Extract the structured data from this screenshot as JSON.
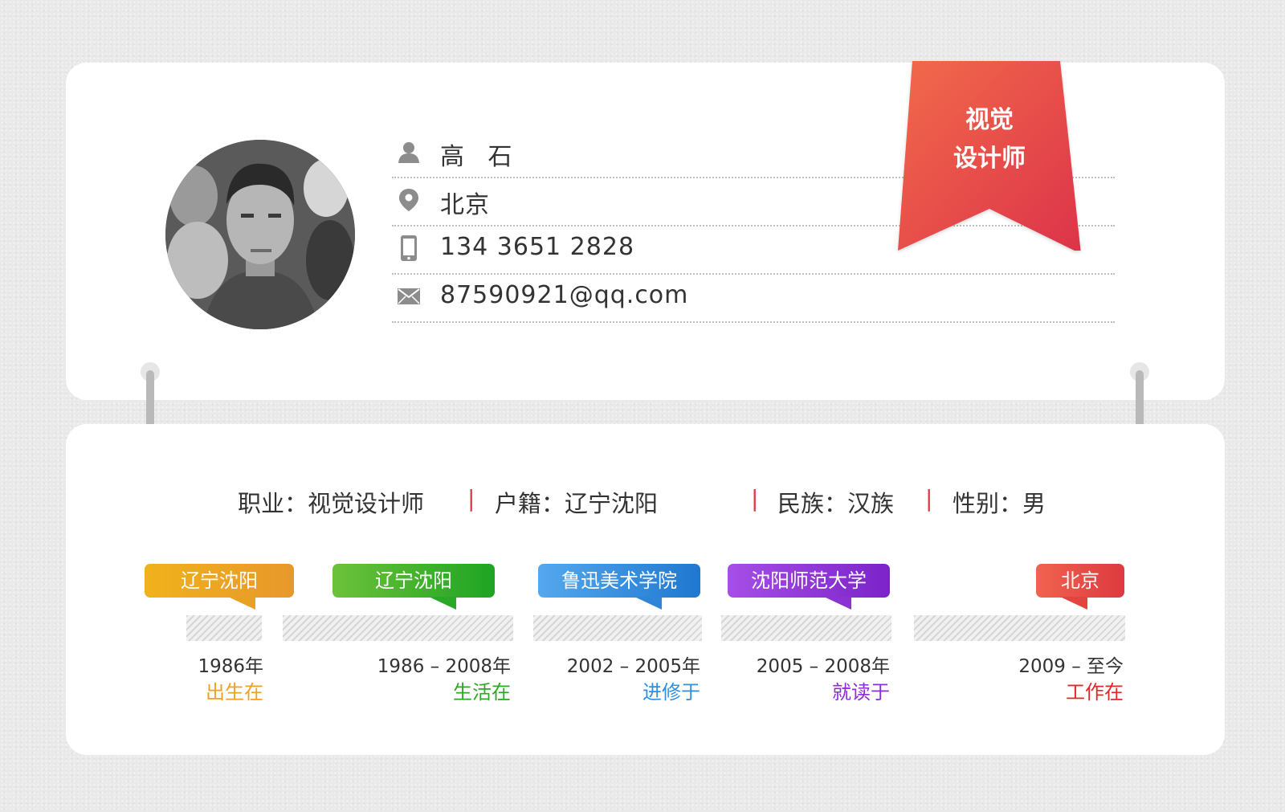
{
  "profile": {
    "name": "高 石",
    "city": "北京",
    "phone": "134  3651  2828",
    "email": "87590921@qq.com",
    "badge_line1": "视觉",
    "badge_line2": "设计师"
  },
  "details": {
    "occupation": "职业：视觉设计师",
    "hometown": "户籍：辽宁沈阳",
    "ethnicity": "民族：汉族",
    "gender": "性别：男",
    "separator": "|"
  },
  "timeline": [
    {
      "place": "辽宁沈阳",
      "date": "1986年",
      "label": "出生在",
      "color": "#eea21f"
    },
    {
      "place": "辽宁沈阳",
      "date": "1986 – 2008年",
      "label": "生活在",
      "color": "#2ea823"
    },
    {
      "place": "鲁迅美术学院",
      "date": "2002 – 2005年",
      "label": "进修于",
      "color": "#2f8fe0"
    },
    {
      "place": "沈阳师范大学",
      "date": "2005 – 2008年",
      "label": "就读于",
      "color": "#8c2fd6"
    },
    {
      "place": "北京",
      "date": "2009 – 至今",
      "label": "工作在",
      "color": "#e02a2a"
    }
  ],
  "icons": {
    "name": "user-icon",
    "city": "location-pin-icon",
    "phone": "mobile-phone-icon",
    "email": "envelope-icon"
  }
}
